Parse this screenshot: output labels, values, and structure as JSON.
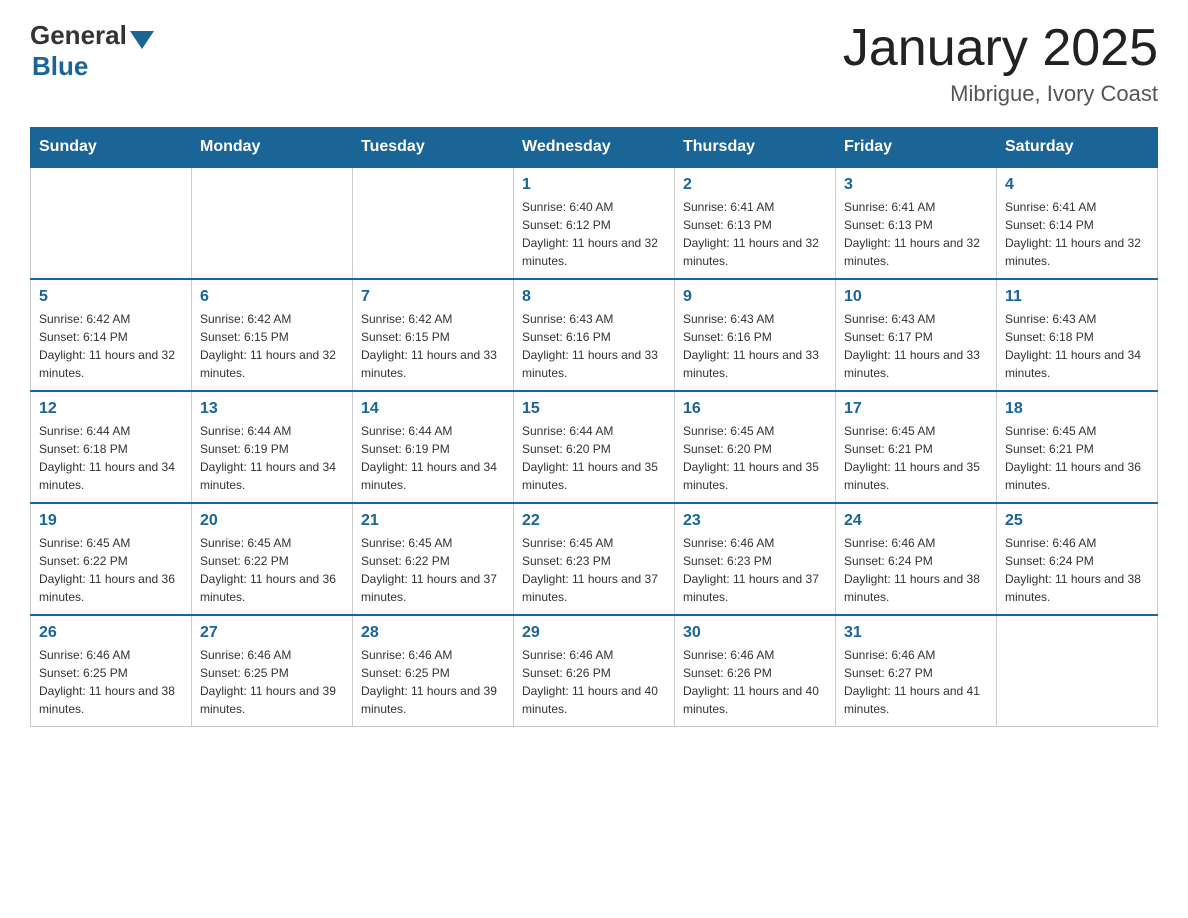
{
  "header": {
    "logo_general": "General",
    "logo_blue": "Blue",
    "title": "January 2025",
    "subtitle": "Mibrigue, Ivory Coast"
  },
  "days_of_week": [
    "Sunday",
    "Monday",
    "Tuesday",
    "Wednesday",
    "Thursday",
    "Friday",
    "Saturday"
  ],
  "weeks": [
    [
      {
        "day": "",
        "info": ""
      },
      {
        "day": "",
        "info": ""
      },
      {
        "day": "",
        "info": ""
      },
      {
        "day": "1",
        "info": "Sunrise: 6:40 AM\nSunset: 6:12 PM\nDaylight: 11 hours and 32 minutes."
      },
      {
        "day": "2",
        "info": "Sunrise: 6:41 AM\nSunset: 6:13 PM\nDaylight: 11 hours and 32 minutes."
      },
      {
        "day": "3",
        "info": "Sunrise: 6:41 AM\nSunset: 6:13 PM\nDaylight: 11 hours and 32 minutes."
      },
      {
        "day": "4",
        "info": "Sunrise: 6:41 AM\nSunset: 6:14 PM\nDaylight: 11 hours and 32 minutes."
      }
    ],
    [
      {
        "day": "5",
        "info": "Sunrise: 6:42 AM\nSunset: 6:14 PM\nDaylight: 11 hours and 32 minutes."
      },
      {
        "day": "6",
        "info": "Sunrise: 6:42 AM\nSunset: 6:15 PM\nDaylight: 11 hours and 32 minutes."
      },
      {
        "day": "7",
        "info": "Sunrise: 6:42 AM\nSunset: 6:15 PM\nDaylight: 11 hours and 33 minutes."
      },
      {
        "day": "8",
        "info": "Sunrise: 6:43 AM\nSunset: 6:16 PM\nDaylight: 11 hours and 33 minutes."
      },
      {
        "day": "9",
        "info": "Sunrise: 6:43 AM\nSunset: 6:16 PM\nDaylight: 11 hours and 33 minutes."
      },
      {
        "day": "10",
        "info": "Sunrise: 6:43 AM\nSunset: 6:17 PM\nDaylight: 11 hours and 33 minutes."
      },
      {
        "day": "11",
        "info": "Sunrise: 6:43 AM\nSunset: 6:18 PM\nDaylight: 11 hours and 34 minutes."
      }
    ],
    [
      {
        "day": "12",
        "info": "Sunrise: 6:44 AM\nSunset: 6:18 PM\nDaylight: 11 hours and 34 minutes."
      },
      {
        "day": "13",
        "info": "Sunrise: 6:44 AM\nSunset: 6:19 PM\nDaylight: 11 hours and 34 minutes."
      },
      {
        "day": "14",
        "info": "Sunrise: 6:44 AM\nSunset: 6:19 PM\nDaylight: 11 hours and 34 minutes."
      },
      {
        "day": "15",
        "info": "Sunrise: 6:44 AM\nSunset: 6:20 PM\nDaylight: 11 hours and 35 minutes."
      },
      {
        "day": "16",
        "info": "Sunrise: 6:45 AM\nSunset: 6:20 PM\nDaylight: 11 hours and 35 minutes."
      },
      {
        "day": "17",
        "info": "Sunrise: 6:45 AM\nSunset: 6:21 PM\nDaylight: 11 hours and 35 minutes."
      },
      {
        "day": "18",
        "info": "Sunrise: 6:45 AM\nSunset: 6:21 PM\nDaylight: 11 hours and 36 minutes."
      }
    ],
    [
      {
        "day": "19",
        "info": "Sunrise: 6:45 AM\nSunset: 6:22 PM\nDaylight: 11 hours and 36 minutes."
      },
      {
        "day": "20",
        "info": "Sunrise: 6:45 AM\nSunset: 6:22 PM\nDaylight: 11 hours and 36 minutes."
      },
      {
        "day": "21",
        "info": "Sunrise: 6:45 AM\nSunset: 6:22 PM\nDaylight: 11 hours and 37 minutes."
      },
      {
        "day": "22",
        "info": "Sunrise: 6:45 AM\nSunset: 6:23 PM\nDaylight: 11 hours and 37 minutes."
      },
      {
        "day": "23",
        "info": "Sunrise: 6:46 AM\nSunset: 6:23 PM\nDaylight: 11 hours and 37 minutes."
      },
      {
        "day": "24",
        "info": "Sunrise: 6:46 AM\nSunset: 6:24 PM\nDaylight: 11 hours and 38 minutes."
      },
      {
        "day": "25",
        "info": "Sunrise: 6:46 AM\nSunset: 6:24 PM\nDaylight: 11 hours and 38 minutes."
      }
    ],
    [
      {
        "day": "26",
        "info": "Sunrise: 6:46 AM\nSunset: 6:25 PM\nDaylight: 11 hours and 38 minutes."
      },
      {
        "day": "27",
        "info": "Sunrise: 6:46 AM\nSunset: 6:25 PM\nDaylight: 11 hours and 39 minutes."
      },
      {
        "day": "28",
        "info": "Sunrise: 6:46 AM\nSunset: 6:25 PM\nDaylight: 11 hours and 39 minutes."
      },
      {
        "day": "29",
        "info": "Sunrise: 6:46 AM\nSunset: 6:26 PM\nDaylight: 11 hours and 40 minutes."
      },
      {
        "day": "30",
        "info": "Sunrise: 6:46 AM\nSunset: 6:26 PM\nDaylight: 11 hours and 40 minutes."
      },
      {
        "day": "31",
        "info": "Sunrise: 6:46 AM\nSunset: 6:27 PM\nDaylight: 11 hours and 41 minutes."
      },
      {
        "day": "",
        "info": ""
      }
    ]
  ]
}
